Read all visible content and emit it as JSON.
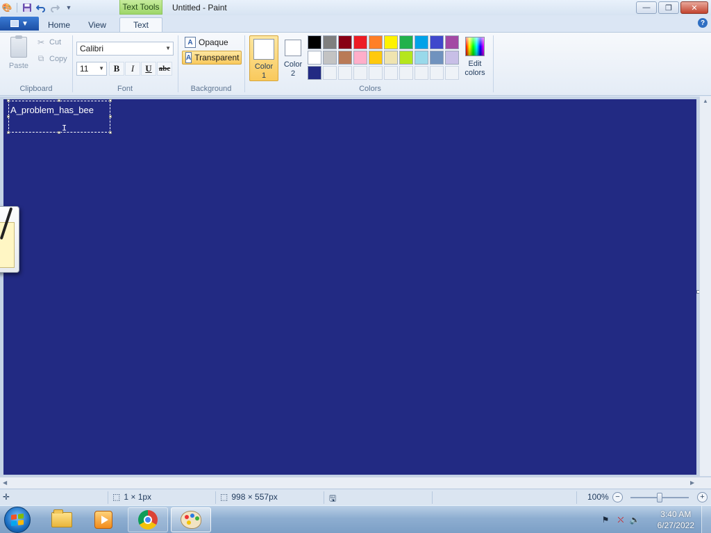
{
  "window": {
    "title": "Untitled - Paint",
    "context_tab": "Text Tools",
    "minimize": "—",
    "maximize": "❐",
    "close": "✕"
  },
  "quick_access": {
    "save_icon": "save-icon",
    "undo_icon": "undo-icon",
    "redo_icon": "redo-icon",
    "customize_icon": "dropdown-icon"
  },
  "tabs": [
    {
      "label": "Home"
    },
    {
      "label": "View"
    },
    {
      "label": "Text"
    }
  ],
  "help_label": "?",
  "clipboard": {
    "paste": "Paste",
    "cut": "Cut",
    "copy": "Copy",
    "group": "Clipboard"
  },
  "font": {
    "family": "Calibri",
    "size": "11",
    "bold": "B",
    "italic": "I",
    "underline": "U",
    "strike": "abc",
    "group": "Font"
  },
  "background": {
    "opaque": "Opaque",
    "transparent": "Transparent",
    "icon_letter": "A",
    "group": "Background",
    "selected": "Transparent"
  },
  "colors": {
    "color1_label_a": "Color",
    "color1_label_b": "1",
    "color2_label_a": "Color",
    "color2_label_b": "2",
    "color1": "#ffffff",
    "color2": "#ffffff",
    "edit_a": "Edit",
    "edit_b": "colors",
    "group": "Colors",
    "palette": [
      "#000000",
      "#7f7f7f",
      "#880015",
      "#ed1c24",
      "#ff7f27",
      "#fff200",
      "#22b14c",
      "#00a2e8",
      "#3f48cc",
      "#a349a4",
      "#ffffff",
      "#c3c3c3",
      "#b97a57",
      "#ffaec9",
      "#ffc90e",
      "#efe4b0",
      "#b5e61d",
      "#99d9ea",
      "#7092be",
      "#c8bfe7",
      "#222a83",
      "",
      "",
      "",
      "",
      "",
      "",
      "",
      "",
      ""
    ]
  },
  "canvas": {
    "background": "#222a83",
    "text": "A_problem_has_bee"
  },
  "status": {
    "cursor_pos": "",
    "selection_size": "1 × 1px",
    "image_size": "998 × 557px",
    "zoom": "100%",
    "zoom_minus": "−",
    "zoom_plus": "+"
  },
  "taskbar": {
    "apps": [
      "file-explorer",
      "media-player",
      "chrome",
      "paint"
    ],
    "time": "3:40 AM",
    "date": "6/27/2022"
  }
}
